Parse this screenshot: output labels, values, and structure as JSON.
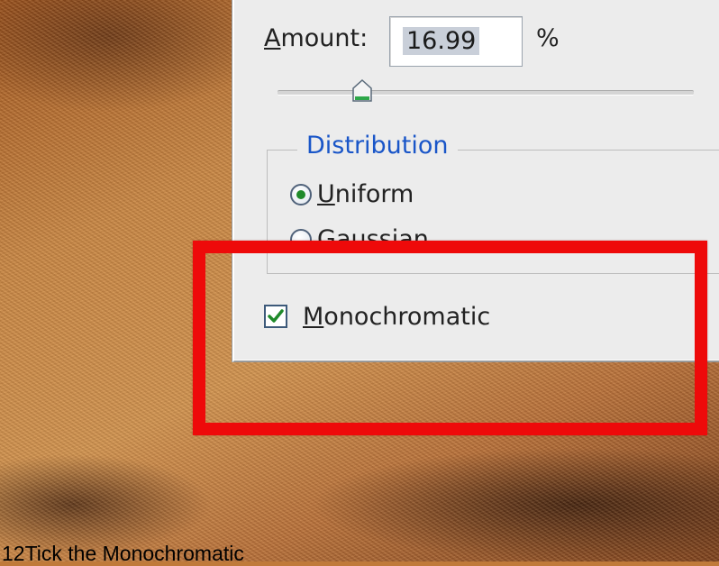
{
  "dialog": {
    "amount": {
      "label_first": "A",
      "label_rest": "mount:",
      "value": "16.99",
      "unit": "%"
    },
    "slider": {
      "level_percent": 17
    },
    "distribution": {
      "legend": "Distribution",
      "options": [
        {
          "label_first": "U",
          "label_rest": "niform",
          "selected": true
        },
        {
          "label_first": "G",
          "label_rest": "aussian",
          "selected": false
        }
      ]
    },
    "monochromatic": {
      "label_first": "M",
      "label_rest": "onochromatic",
      "checked": true
    }
  },
  "annotation": {
    "highlight_color": "#ee0a0a"
  },
  "caption": "12Tick the Monochromatic",
  "colors": {
    "dialog_bg": "#ececec",
    "legend_text": "#1a56c8",
    "selection_highlight": "#c9cfd9",
    "check_mark": "#1f8a2a"
  }
}
